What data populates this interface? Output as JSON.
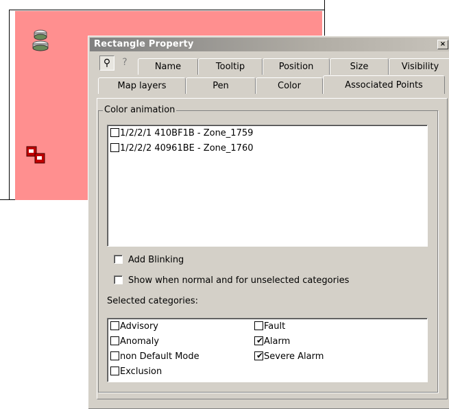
{
  "dialog": {
    "title": "Rectangle Property",
    "close_glyph": "×"
  },
  "tabs_row1": [
    {
      "label": "Name"
    },
    {
      "label": "Tooltip"
    },
    {
      "label": "Position"
    },
    {
      "label": "Size"
    },
    {
      "label": "Visibility"
    }
  ],
  "tabs_row2": [
    {
      "label": "Map layers"
    },
    {
      "label": "Pen"
    },
    {
      "label": "Color"
    },
    {
      "label": "Associated Points"
    }
  ],
  "icons": {
    "pin": "⚲",
    "help": "?"
  },
  "color_animation": {
    "label": "Color animation",
    "points": [
      {
        "label": "1/2/2/1 410BF1B - Zone_1759",
        "checked": false
      },
      {
        "label": "1/2/2/2 40961BE - Zone_1760",
        "checked": false
      }
    ]
  },
  "options": {
    "add_blinking": {
      "label": "Add Blinking",
      "checked": false
    },
    "show_when_normal": {
      "label": "Show when normal and for unselected categories",
      "checked": false
    }
  },
  "categories": {
    "label": "Selected categories:",
    "left": [
      {
        "label": "Advisory",
        "checked": false
      },
      {
        "label": "Anomaly",
        "checked": false
      },
      {
        "label": "non Default Mode",
        "checked": false
      },
      {
        "label": "Exclusion",
        "checked": false
      }
    ],
    "right": [
      {
        "label": "Fault",
        "checked": false
      },
      {
        "label": "Alarm",
        "checked": true
      },
      {
        "label": "Severe Alarm",
        "checked": true
      }
    ]
  },
  "colors": {
    "canvas_rect": "#ff8f8f",
    "dialog_bg": "#d4d0c8"
  },
  "check_glyph": "✔"
}
